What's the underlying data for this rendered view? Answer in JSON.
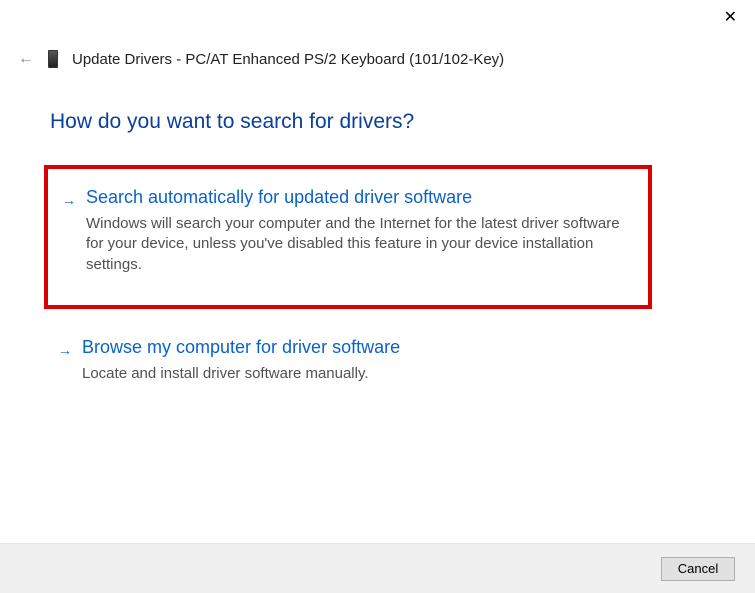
{
  "close": "✕",
  "header": {
    "back_arrow": "←",
    "title": "Update Drivers - PC/AT Enhanced PS/2 Keyboard (101/102-Key)"
  },
  "heading": "How do you want to search for drivers?",
  "options": {
    "auto": {
      "arrow": "→",
      "title": "Search automatically for updated driver software",
      "desc": "Windows will search your computer and the Internet for the latest driver software for your device, unless you've disabled this feature in your device installation settings."
    },
    "manual": {
      "arrow": "→",
      "title": "Browse my computer for driver software",
      "desc": "Locate and install driver software manually."
    }
  },
  "footer": {
    "cancel": "Cancel"
  }
}
